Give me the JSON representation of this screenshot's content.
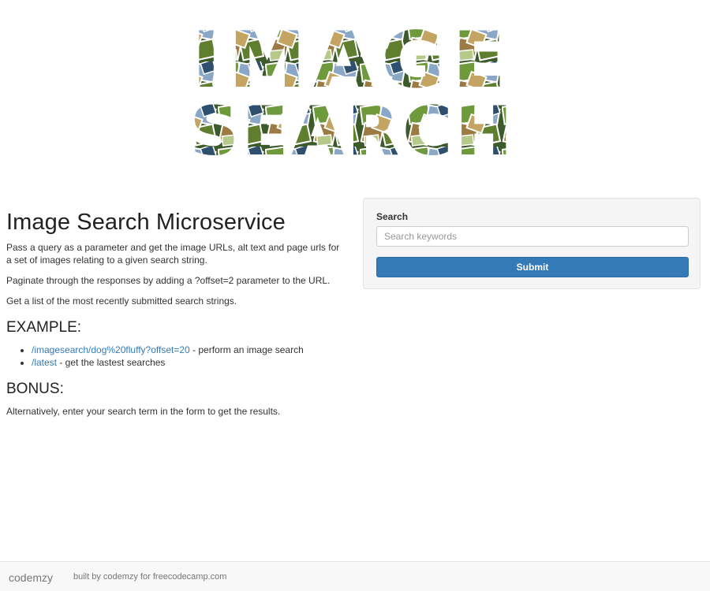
{
  "logo": {
    "line1": "IMAGE",
    "line2": "SEARCH"
  },
  "main": {
    "title": "Image Search Microservice",
    "paragraphs": [
      "Pass a query as a parameter and get the image URLs, alt text and page urls for a set of images relating to a given search string.",
      "Paginate through the responses by adding a ?offset=2 parameter to the URL.",
      "Get a list of the most recently submitted search strings."
    ],
    "example_heading": "EXAMPLE:",
    "examples": [
      {
        "link": "/imagesearch/dog%20fluffy?offset=20",
        "text": " - perform an image search"
      },
      {
        "link": "/latest",
        "text": " - get the lastest searches"
      }
    ],
    "bonus_heading": "BONUS:",
    "bonus_text": "Alternatively, enter your search term in the form to get the results."
  },
  "search": {
    "label": "Search",
    "placeholder": "Search keywords",
    "value": "",
    "submit_label": "Submit"
  },
  "footer": {
    "brand": "codemzy",
    "text": "built by codemzy for freecodecamp.com"
  },
  "colors": {
    "primary_button": "#337ab7",
    "link": "#337ab7",
    "panel_bg": "#f5f5f5",
    "footer_bg": "#f8f8f8"
  }
}
